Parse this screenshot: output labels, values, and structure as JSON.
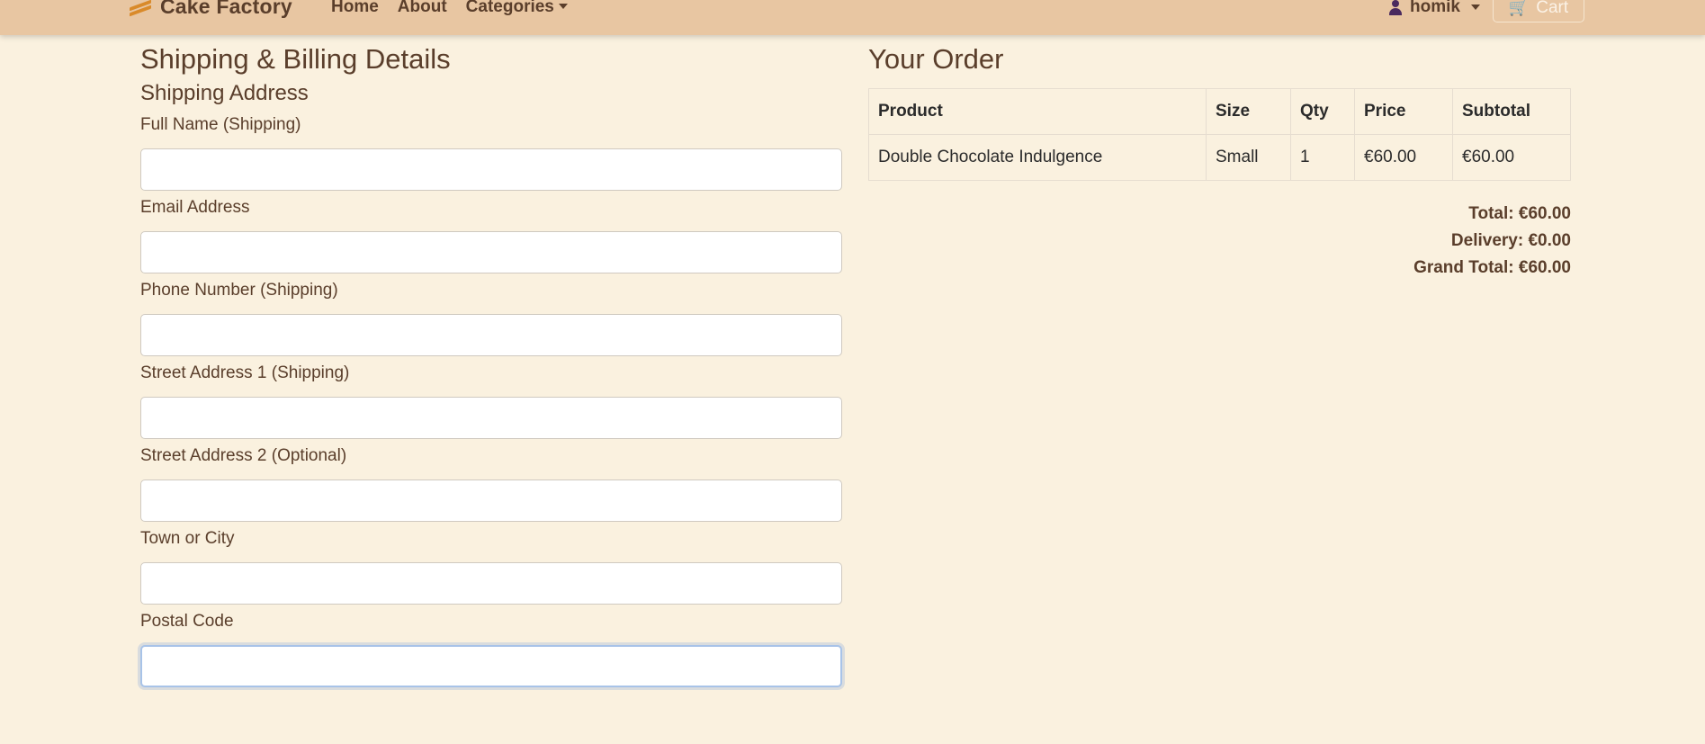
{
  "navbar": {
    "brand": "Cake Factory",
    "links": {
      "home": "Home",
      "about": "About",
      "categories": "Categories"
    },
    "user": "homik",
    "cart": "Cart"
  },
  "form": {
    "title": "Shipping & Billing Details",
    "section": "Shipping Address",
    "fields": [
      {
        "label": "Full Name (Shipping)",
        "value": "",
        "placeholder": ""
      },
      {
        "label": "Email Address",
        "value": "",
        "placeholder": ""
      },
      {
        "label": "Phone Number (Shipping)",
        "value": "",
        "placeholder": ""
      },
      {
        "label": "Street Address 1 (Shipping)",
        "value": "",
        "placeholder": ""
      },
      {
        "label": "Street Address 2 (Optional)",
        "value": "",
        "placeholder": ""
      },
      {
        "label": "Town or City",
        "value": "",
        "placeholder": ""
      },
      {
        "label": "Postal Code",
        "value": "",
        "placeholder": ""
      }
    ]
  },
  "order": {
    "title": "Your Order",
    "columns": [
      "Product",
      "Size",
      "Qty",
      "Price",
      "Subtotal"
    ],
    "rows": [
      [
        "Double Chocolate Indulgence",
        "Small",
        "1",
        "€60.00",
        "€60.00"
      ]
    ],
    "total": "Total: €60.00",
    "delivery": "Delivery: €0.00",
    "grand_total": "Grand Total: €60.00"
  },
  "colors": {
    "navbar_bg": "#e8c6a2",
    "page_bg": "#faf1df",
    "text": "#5a3e2b",
    "brand_icon": "#d98a2a"
  }
}
